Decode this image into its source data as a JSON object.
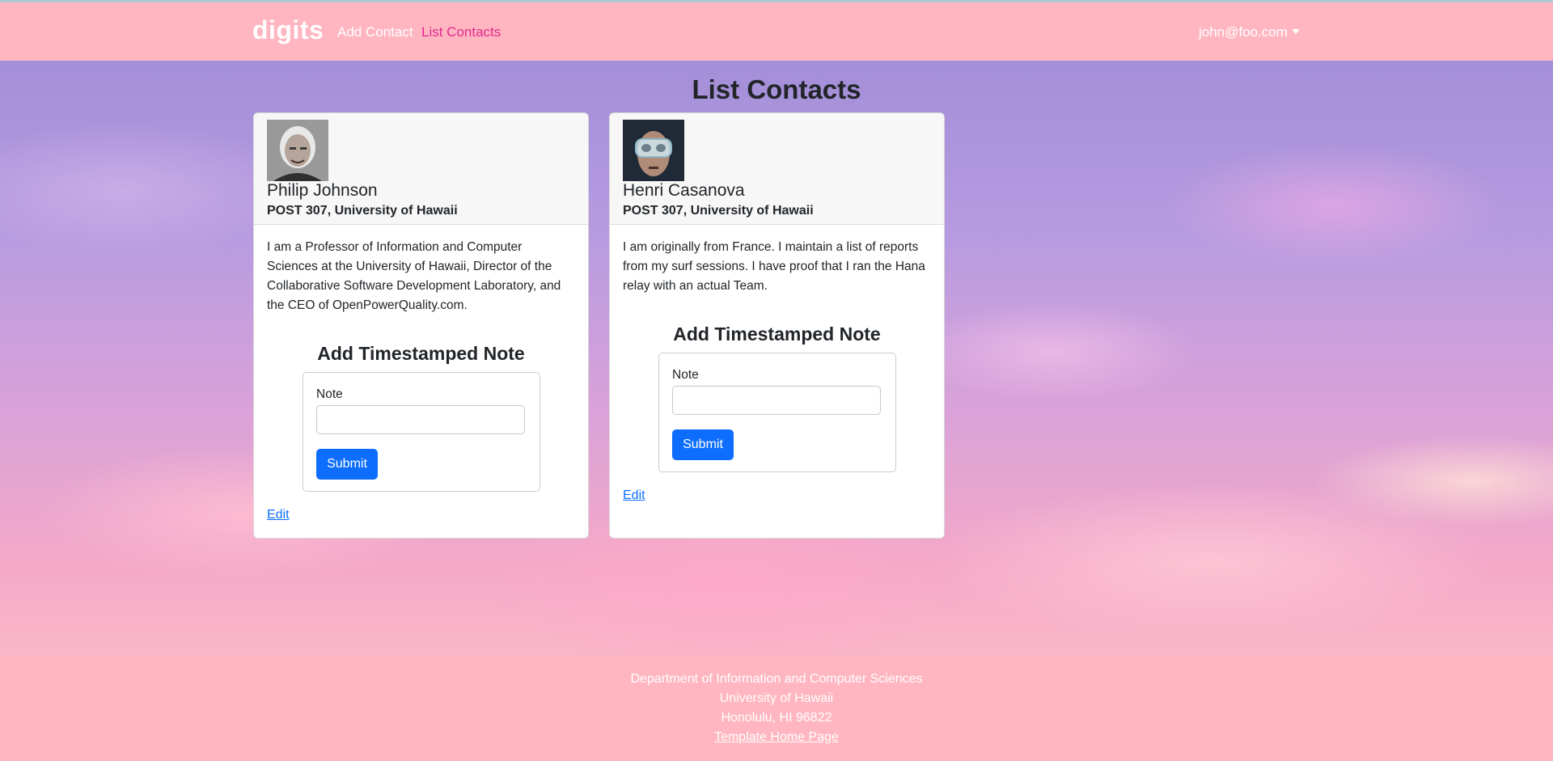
{
  "navbar": {
    "brand": "digits",
    "links": [
      {
        "label": "Add Contact",
        "active": false
      },
      {
        "label": "List Contacts",
        "active": true
      }
    ],
    "user": "john@foo.com"
  },
  "page": {
    "title": "List Contacts"
  },
  "contacts": [
    {
      "name": "Philip Johnson",
      "address": "POST 307, University of Hawaii",
      "description": "I am a Professor of Information and Computer Sciences at the University of Hawaii, Director of the Collaborative Software Development Laboratory, and the CEO of OpenPowerQuality.com.",
      "note_title": "Add Timestamped Note",
      "note_label": "Note",
      "note_value": "",
      "submit_label": "Submit",
      "edit_label": "Edit"
    },
    {
      "name": "Henri Casanova",
      "address": "POST 307, University of Hawaii",
      "description": "I am originally from France. I maintain a list of reports from my surf sessions. I have proof that I ran the Hana relay with an actual Team.",
      "note_title": "Add Timestamped Note",
      "note_label": "Note",
      "note_value": "",
      "submit_label": "Submit",
      "edit_label": "Edit"
    }
  ],
  "footer": {
    "line1": "Department of Information and Computer Sciences",
    "line2": "University of Hawaii",
    "line3": "Honolulu, HI 96822",
    "link": "Template Home Page"
  },
  "colors": {
    "navbar": "#ffb6c1",
    "active_link": "#e0298d",
    "primary_button": "#0d6efd"
  }
}
